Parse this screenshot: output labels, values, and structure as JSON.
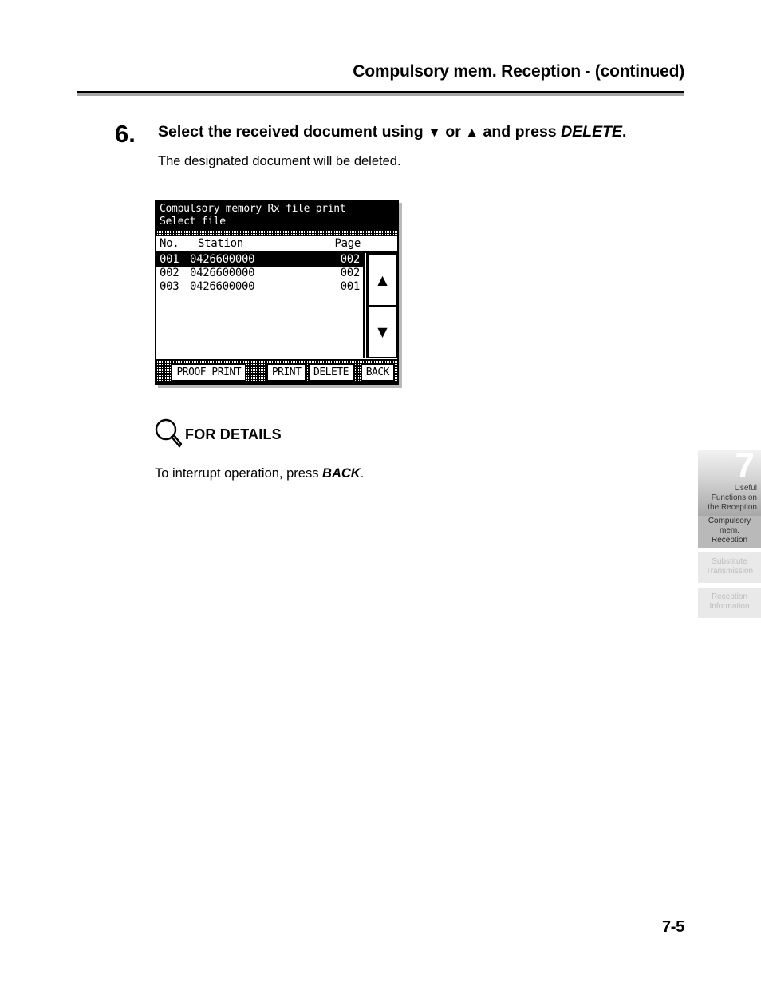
{
  "header": {
    "title": "Compulsory mem. Reception -  (continued)"
  },
  "step": {
    "number": "6.",
    "text_part1": "Select  the  received  document  using ",
    "icon_down": "▼",
    "text_or": " or ",
    "icon_up": "▲",
    "text_part2": " and  press ",
    "emphasis": "DELETE",
    "period": ".",
    "sub_text": "The designated document will be deleted."
  },
  "lcd": {
    "title_line1": "Compulsory memory Rx file print",
    "title_line2": "Select file",
    "columns": {
      "no": "No.",
      "station": "Station",
      "page": "Page"
    },
    "rows": [
      {
        "no": "001",
        "station": "0426600000",
        "page": "002",
        "selected": true
      },
      {
        "no": "002",
        "station": "0426600000",
        "page": "002",
        "selected": false
      },
      {
        "no": "003",
        "station": "0426600000",
        "page": "001",
        "selected": false
      }
    ],
    "scroll": {
      "up_icon": "▲",
      "down_icon": "▼"
    },
    "buttons": {
      "proof_print": "PROOF PRINT",
      "print": "PRINT",
      "delete": "DELETE",
      "back": "BACK"
    }
  },
  "for_details": {
    "label": "FOR DETAILS",
    "body_prefix": "To interrupt operation, press ",
    "body_emphasis": "BACK",
    "body_suffix": "."
  },
  "side_tabs": {
    "chapter_number": "7",
    "chapter_line1": "Useful",
    "chapter_line2": "Functions on",
    "chapter_line3": "the Reception",
    "items": [
      {
        "line1": "Compulsory",
        "line2": "mem. Reception",
        "active": true
      },
      {
        "line1": "Substitute",
        "line2": "Transmission",
        "active": false
      },
      {
        "line1": "Reception",
        "line2": "Information",
        "active": false
      }
    ]
  },
  "folio": {
    "page_number": "7-5"
  },
  "colors": {
    "rule_dark": "#000000",
    "rule_light": "#a6a6a6",
    "tab_active": "#b9b9b9",
    "tab_inactive": "#e9e9e9",
    "tab_inactive_text": "#bcbcbc"
  }
}
